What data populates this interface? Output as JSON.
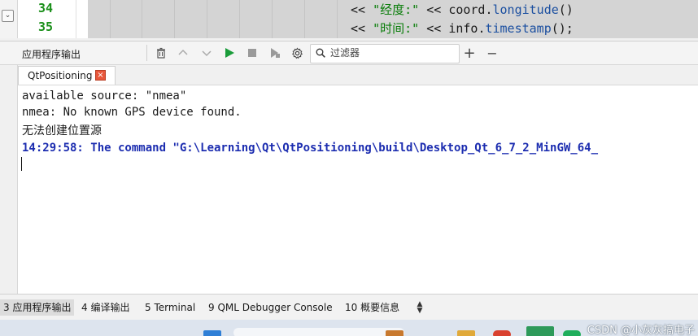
{
  "editor": {
    "line_numbers": [
      "34",
      "35"
    ],
    "line1": {
      "op1": "<<",
      "str": "\"经度:\"",
      "op2": "<<",
      "obj": "coord",
      "dot": ".",
      "method": "longitude",
      "tail": "()"
    },
    "line2": {
      "op1": "<<",
      "str": "\"时间:\"",
      "op2": "<<",
      "obj": "info",
      "dot": ".",
      "method": "timestamp",
      "tail": "();"
    }
  },
  "toolbar": {
    "title": "应用程序输出",
    "filter_placeholder": "过滤器",
    "add_label": "+",
    "minimize_label": "−"
  },
  "output_tab": {
    "label": "QtPositioning",
    "close_label": "×"
  },
  "output_lines": [
    "available source: \"nmea\"",
    "nmea: No known GPS device found.",
    "无法创建位置源",
    "14:29:58: The command \"G:\\Learning\\Qt\\QtPositioning\\build\\Desktop_Qt_6_7_2_MinGW_64_"
  ],
  "panes": [
    {
      "label": "3 应用程序输出",
      "active": true
    },
    {
      "label": "4 编译输出",
      "active": false
    },
    {
      "label": "5 Terminal",
      "active": false
    },
    {
      "label": "9 QML Debugger Console",
      "active": false
    },
    {
      "label": "10 概要信息",
      "active": false
    }
  ],
  "watermark": "CSDN @小灰灰搞电子",
  "colors": {
    "line_number": "#1a8f1a",
    "string": "#0a7d0a",
    "output_bold": "#1c2db0",
    "close_badge": "#e8563a",
    "run_green": "#1a9c3a"
  }
}
